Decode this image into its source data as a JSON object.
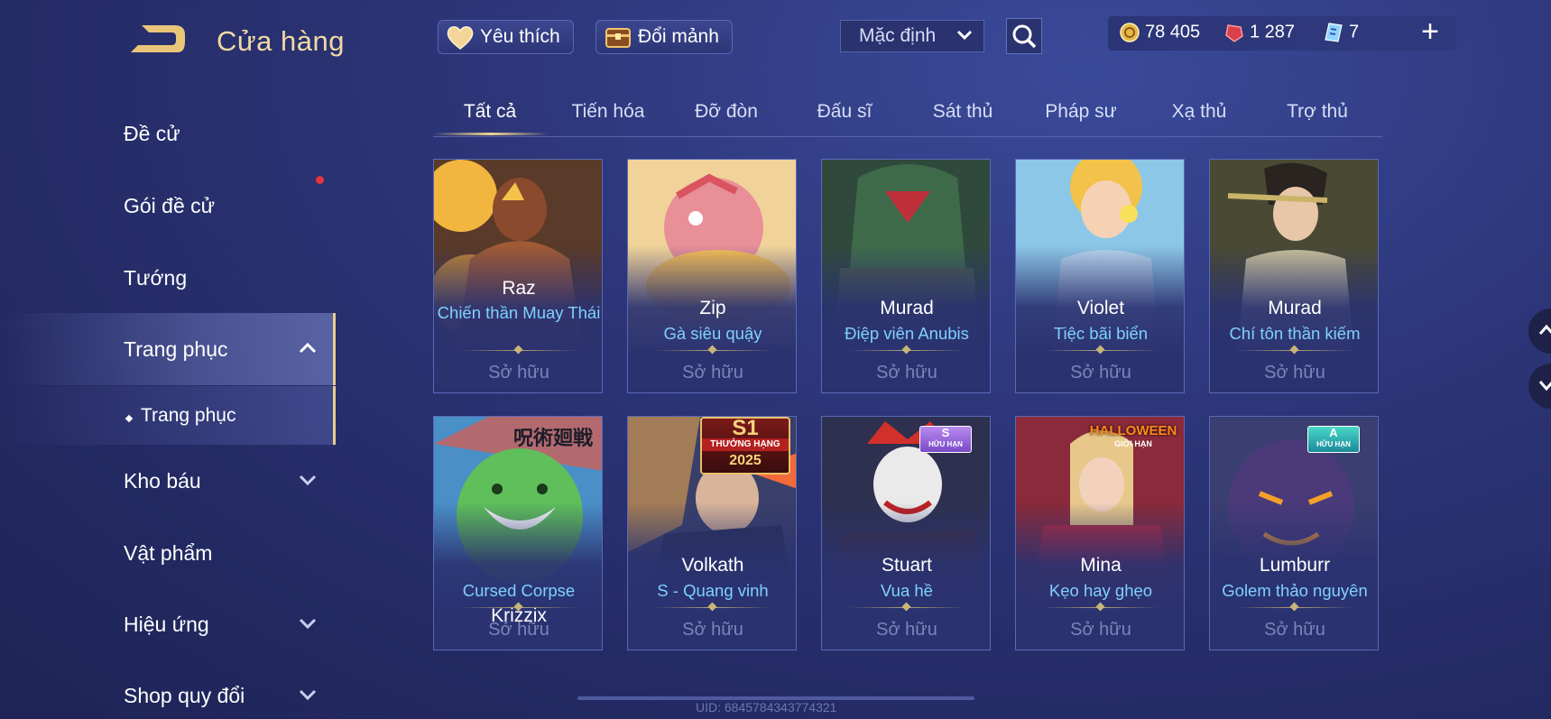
{
  "header": {
    "title": "Cửa hàng",
    "favorite_label": "Yêu thích",
    "exchange_label": "Đổi mảnh",
    "sort_value": "Mặc định",
    "currencies": [
      {
        "icon": "gold-coin-icon",
        "value": "78 405"
      },
      {
        "icon": "ruby-gem-icon",
        "value": "1 287"
      },
      {
        "icon": "voucher-icon",
        "value": "7"
      }
    ],
    "plus_label": "+"
  },
  "sidebar": {
    "items": [
      {
        "label": "Đề cử"
      },
      {
        "label": "Gói đề cử"
      },
      {
        "label": "Tướng"
      },
      {
        "label": "Trang phục"
      },
      {
        "label": "Trang phục"
      },
      {
        "label": "Kho báu"
      },
      {
        "label": "Vật phẩm"
      },
      {
        "label": "Hiệu ứng"
      },
      {
        "label": "Shop quy đổi"
      }
    ]
  },
  "tabs": [
    "Tất cả",
    "Tiến hóa",
    "Đỡ đòn",
    "Đấu sĩ",
    "Sát thủ",
    "Pháp sư",
    "Xạ thủ",
    "Trợ thủ"
  ],
  "cards": [
    {
      "hero": "Raz",
      "skin": "Chiến thần Muay Thái",
      "status": "Sở hữu"
    },
    {
      "hero": "Zip",
      "skin": "Gà siêu quậy",
      "status": "Sở hữu"
    },
    {
      "hero": "Murad",
      "skin": "Điệp viên Anubis",
      "status": "Sở hữu"
    },
    {
      "hero": "Violet",
      "skin": "Tiệc bãi biển",
      "status": "Sở hữu"
    },
    {
      "hero": "Murad",
      "skin": "Chí tôn thần kiếm",
      "status": "Sở hữu"
    },
    {
      "hero": "Krizzix",
      "skin": "Cursed Corpse",
      "status": "Sở hữu"
    },
    {
      "hero": "Volkath",
      "skin": "S - Quang vinh",
      "status": "Sở hữu"
    },
    {
      "hero": "Stuart",
      "skin": "Vua hề",
      "status": "Sở hữu"
    },
    {
      "hero": "Mina",
      "skin": "Kẹo hay ghẹo",
      "status": "Sở hữu"
    },
    {
      "hero": "Lumburr",
      "skin": "Golem thảo nguyên",
      "status": "Sở hữu"
    }
  ],
  "badges": {
    "krizzix": "呪術廻戦",
    "volkath_top": "S1",
    "volkath_mid": "THƯỞNG HẠNG",
    "volkath_year": "2025",
    "stuart_tier": "S",
    "stuart_sub": "HỮU HẠN",
    "mina_top": "HALLOWEEN",
    "mina_sub": "GIỚI HẠN",
    "lumburr_tier": "A",
    "lumburr_sub": "HỮU HẠN"
  },
  "uid": "UID: 6845784343774321",
  "colors": {
    "accent_gold": "#f2d9a2",
    "skin_name": "#7fd0ff",
    "owned": "#7c85b8"
  }
}
